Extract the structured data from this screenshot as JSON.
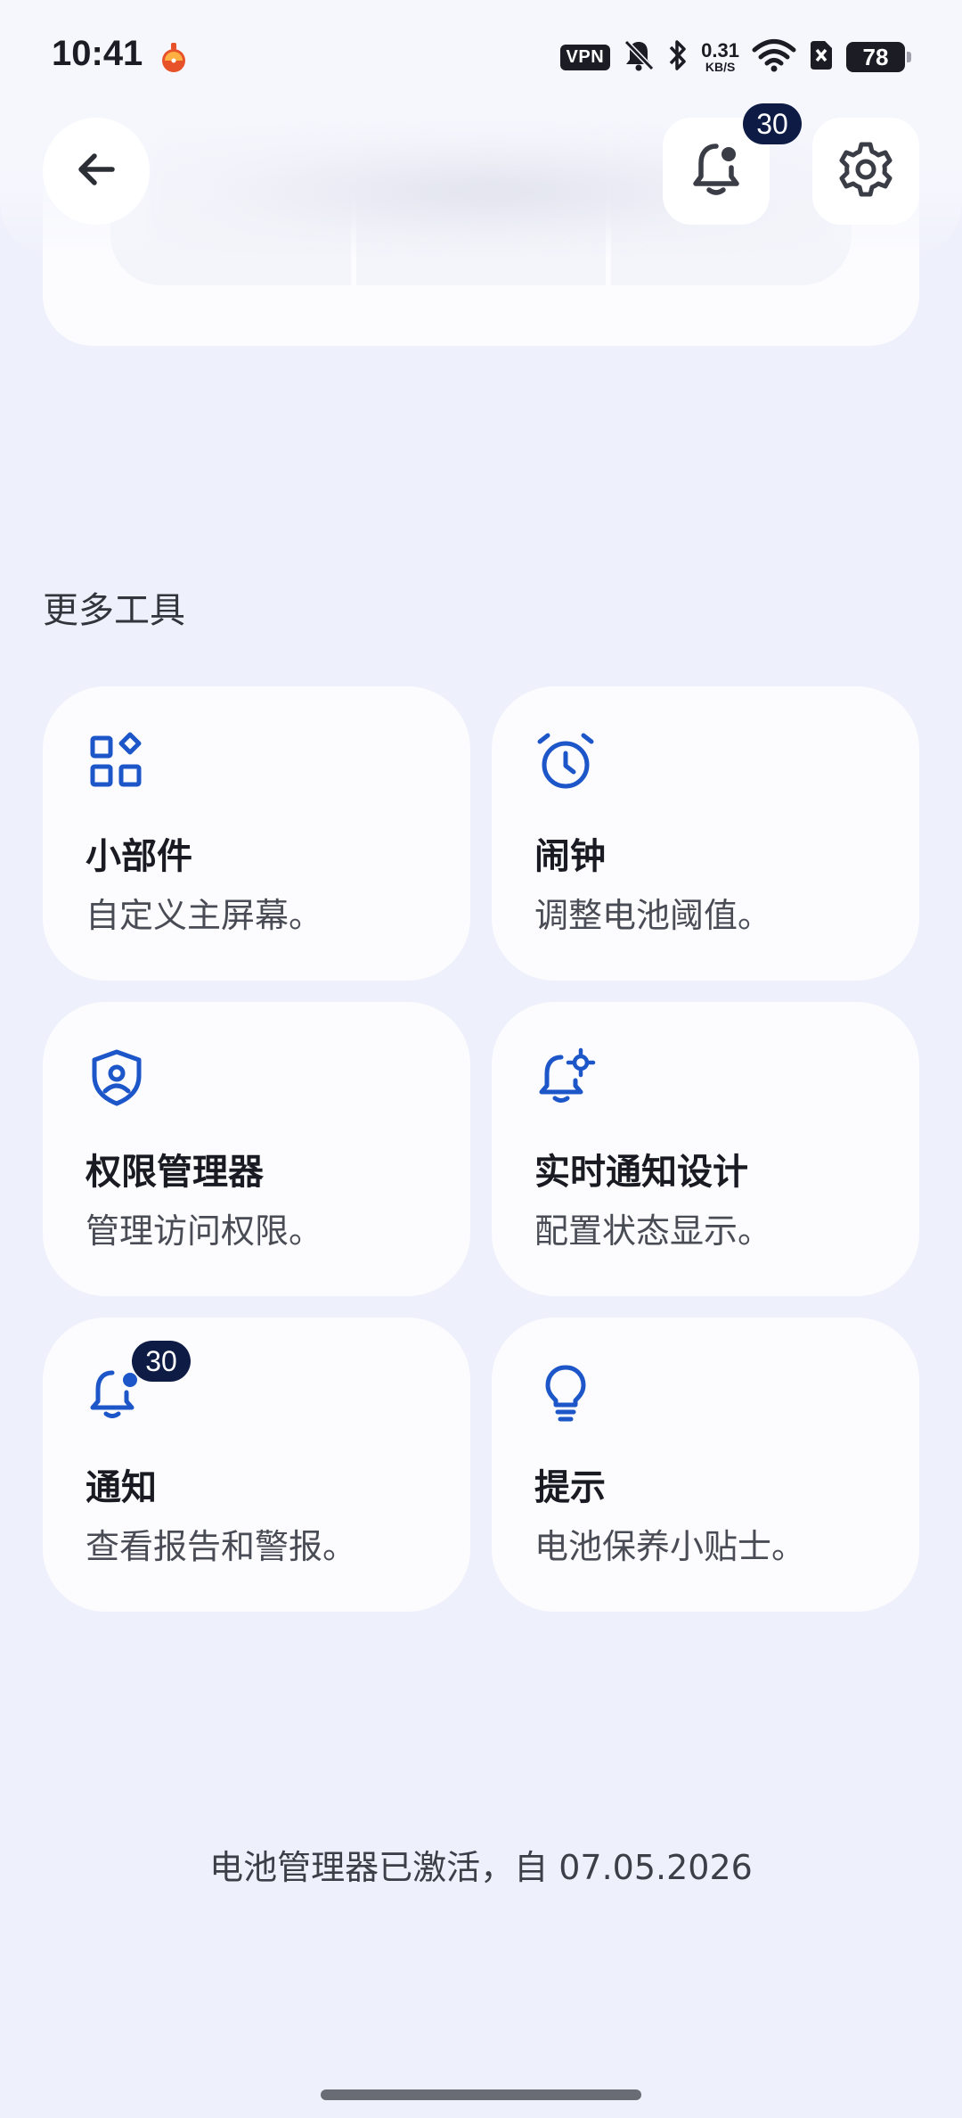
{
  "status_bar": {
    "time": "10:41",
    "vpn": "VPN",
    "net_speed_value": "0.31",
    "net_speed_unit": "KB/S",
    "battery": "78"
  },
  "header": {
    "notification_count": "30"
  },
  "section": {
    "title": "更多工具"
  },
  "tools": [
    {
      "title": "小部件",
      "desc": "自定义主屏幕。",
      "icon": "widgets-icon"
    },
    {
      "title": "闹钟",
      "desc": "调整电池阈值。",
      "icon": "alarm-clock-icon"
    },
    {
      "title": "权限管理器",
      "desc": "管理访问权限。",
      "icon": "shield-user-icon"
    },
    {
      "title": "实时通知设计",
      "desc": "配置状态显示。",
      "icon": "bell-settings-icon"
    },
    {
      "title": "通知",
      "desc": "查看报告和警报。",
      "icon": "bell-dot-icon",
      "badge": "30"
    },
    {
      "title": "提示",
      "desc": "电池保养小贴士。",
      "icon": "lightbulb-icon"
    }
  ],
  "footer": {
    "note": "电池管理器已激活，自 07.05.2026"
  },
  "colors": {
    "background": "#eef0fb",
    "card": "#fcfcff",
    "accent": "#1d56c8",
    "badge": "#0d1b45"
  }
}
